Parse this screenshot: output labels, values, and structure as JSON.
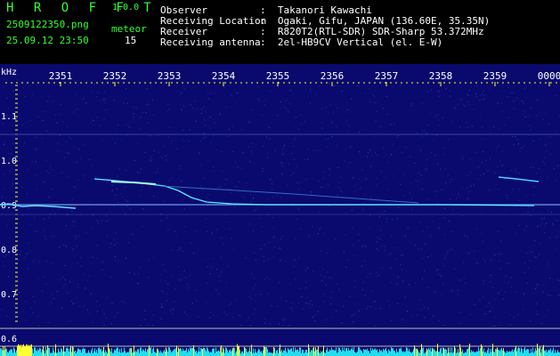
{
  "app": {
    "name": "H R O F F T",
    "version": "1.0.0"
  },
  "file": {
    "name": "2509122350.png",
    "datetime": "25.09.12 23:50"
  },
  "meteor": {
    "label": "meteor",
    "count": "15"
  },
  "info": [
    {
      "label": "Observer",
      "value": ":  Takanori Kawachi"
    },
    {
      "label": "Receiving Location",
      "value": ":  Ogaki, Gifu, JAPAN (136.60E, 35.35N)"
    },
    {
      "label": "Receiver",
      "value": ":  R820T2(RTL-SDR) SDR-Sharp 53.372MHz"
    },
    {
      "label": "Receiving antenna",
      "value": ":  2el-HB9CV Vertical (el. E-W)"
    }
  ],
  "axis": {
    "y_unit": "kHz",
    "y_ticks": [
      "1.1",
      "1.0",
      "0.9",
      "0.8",
      "0.7",
      "0.6"
    ],
    "x_ticks": [
      "2351",
      "2352",
      "2353",
      "2354",
      "2355",
      "2356",
      "2357",
      "2358",
      "2359",
      "0000"
    ]
  },
  "colors": {
    "background": "#000000",
    "header_green": "#33ff33",
    "header_white": "#ffffff",
    "tick_yellow": "#ffff33",
    "spectrum_bg": "#0a0a6e",
    "trace": "#55eeff"
  }
}
